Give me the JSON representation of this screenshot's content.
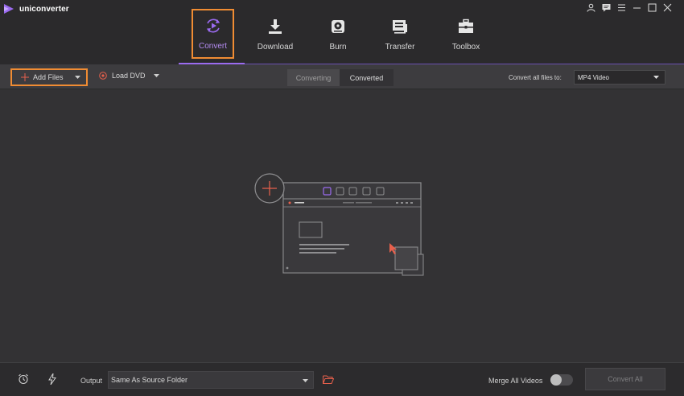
{
  "app": {
    "title": "uniconverter",
    "icon": "play-logo-icon"
  },
  "window_controls": [
    "user-icon",
    "chat-icon",
    "menu-icon",
    "minimize-icon",
    "maximize-icon",
    "close-icon"
  ],
  "nav": {
    "tabs": [
      {
        "label": "Convert",
        "icon": "convert-icon",
        "active": true
      },
      {
        "label": "Download",
        "icon": "download-icon"
      },
      {
        "label": "Burn",
        "icon": "burn-icon"
      },
      {
        "label": "Transfer",
        "icon": "transfer-icon"
      },
      {
        "label": "Toolbox",
        "icon": "toolbox-icon"
      }
    ]
  },
  "toolbar": {
    "add_files": "Add Files",
    "load_dvd": "Load DVD",
    "seg_converting": "Converting",
    "seg_converted": "Converted",
    "convert_all_label": "Convert all files to:",
    "format_value": "MP4 Video"
  },
  "bottom": {
    "output_label": "Output",
    "output_value": "Same As Source Folder",
    "merge_label": "Merge All Videos",
    "merge_on": false,
    "convert_all": "Convert All"
  },
  "colors": {
    "accent_purple": "#9b6bf0",
    "highlight_orange": "#f08c33",
    "plus_red": "#e8604c"
  }
}
